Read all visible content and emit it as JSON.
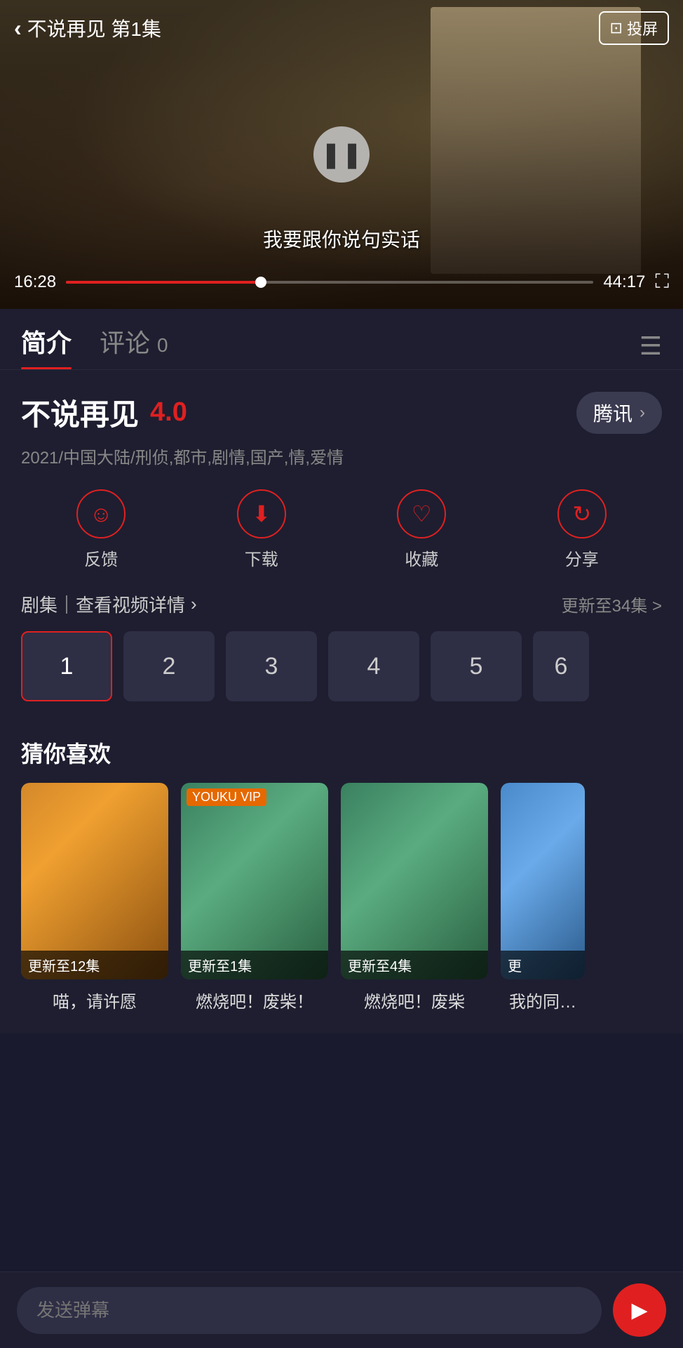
{
  "video": {
    "title": "不说再见 第1集",
    "cast_btn": "投屏",
    "current_time": "16:28",
    "total_time": "44:17",
    "subtitle": "我要跟你说句实话",
    "pause_icon": "❚❚",
    "progress_percent": 37
  },
  "tabs": {
    "intro_label": "简介",
    "comment_label": "评论",
    "comment_count": "0"
  },
  "show": {
    "name": "不说再见",
    "rating": "4.0",
    "platform": "腾讯",
    "meta": "2021/中国大陆/刑侦,都市,剧情,国产,情,爱情"
  },
  "actions": [
    {
      "icon": "☺",
      "label": "反馈"
    },
    {
      "icon": "⬇",
      "label": "下载"
    },
    {
      "icon": "♡",
      "label": "收藏"
    },
    {
      "icon": "↻",
      "label": "分享"
    }
  ],
  "episodes": {
    "left_text": "剧集｜查看视频详情",
    "right_text": "更新至34集 >",
    "numbers": [
      "1",
      "2",
      "3",
      "4",
      "5",
      "6"
    ]
  },
  "recommendations": {
    "title": "猜你喜欢",
    "items": [
      {
        "title": "喵，请许愿",
        "badge": "更新至12集",
        "theme": "qingyuan"
      },
      {
        "title": "燃烧吧！废柴！",
        "badge": "更新至1集",
        "theme": "ranshao1",
        "youku": true
      },
      {
        "title": "燃烧吧！废柴",
        "badge": "更新至4集",
        "theme": "ranshao2"
      },
      {
        "title": "我的同…",
        "badge": "更",
        "theme": "wode",
        "partial": true
      }
    ]
  },
  "bottom": {
    "input_placeholder": "发送弹幕",
    "send_icon": "▶"
  }
}
